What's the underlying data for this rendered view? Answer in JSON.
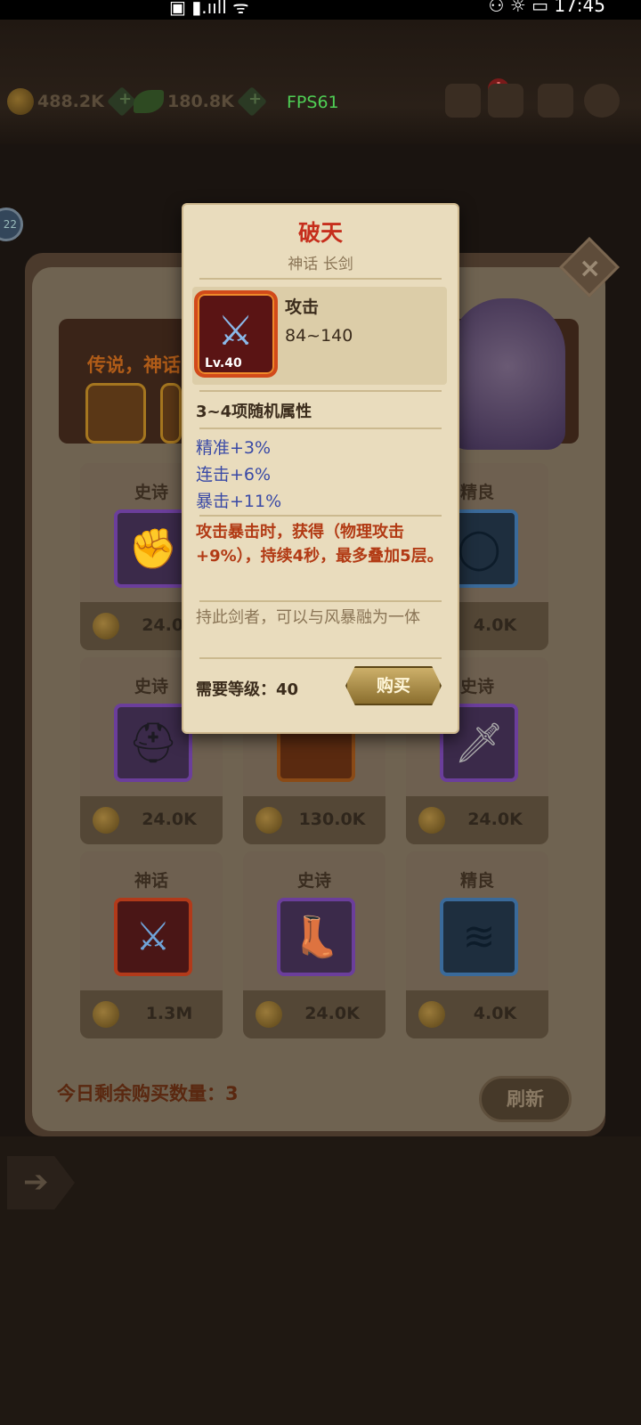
{
  "status": {
    "left": "▣ ▮.ııll ᯤ",
    "right": "⚇ ☼ ▭ 17:45"
  },
  "topbar": {
    "gold": "488.2K",
    "wood": "180.8K",
    "fps": "FPS61",
    "alert": "!"
  },
  "side_badge": "22",
  "banner": {
    "text": "传说，神话"
  },
  "cards": [
    {
      "tier": "史诗",
      "price": "24.0K",
      "rarity": "epic",
      "icon": "gauntlet-icon"
    },
    {
      "tier": "精良",
      "price": "4.0K",
      "rarity": "fine",
      "icon": "necklace-icon"
    },
    {
      "tier": "史诗",
      "price": "24.0K",
      "rarity": "epic",
      "icon": "helmet-icon"
    },
    {
      "tier": "",
      "price": "130.0K",
      "rarity": "myth",
      "icon": "weapon-icon"
    },
    {
      "tier": "史诗",
      "price": "24.0K",
      "rarity": "epic",
      "icon": "dagger-icon"
    },
    {
      "tier": "神话",
      "price": "1.3M",
      "rarity": "myth",
      "icon": "sword-icon"
    },
    {
      "tier": "史诗",
      "price": "24.0K",
      "rarity": "epic",
      "icon": "boot-icon"
    },
    {
      "tier": "精良",
      "price": "4.0K",
      "rarity": "fine",
      "icon": "cloak-icon"
    }
  ],
  "footer": {
    "remain": "今日剩余购买数量：3",
    "refresh": "刷新"
  },
  "tooltip": {
    "name": "破天",
    "subtitle": "神话 长剑",
    "level": "Lv.40",
    "stat_name": "攻击",
    "stat_value": "84~140",
    "random_attrs": "3~4项随机属性",
    "attrs": [
      "精准+3%",
      "连击+6%",
      "暴击+11%"
    ],
    "skill": "攻击暴击时，获得（物理攻击+9%），持续4秒，最多叠加5层。",
    "flavor": "持此剑者，可以与风暴融为一体",
    "requirement": "需要等级：40",
    "buy": "购买"
  }
}
